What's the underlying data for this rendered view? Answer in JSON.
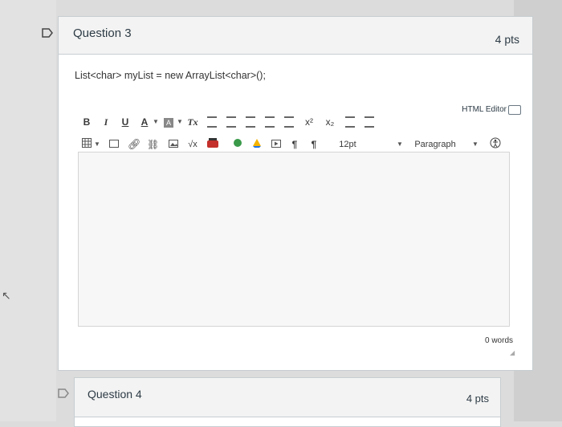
{
  "question3": {
    "title": "Question 3",
    "points": "4 pts",
    "code": "List<char> myList = new ArrayList<char>();",
    "html_editor_label": "HTML Editor",
    "word_count": "0 words",
    "toolbar1": [
      "B",
      "I",
      "U",
      "A",
      "A",
      "Tx",
      "x²",
      "x₂"
    ],
    "toolbar2": {
      "font_size": "12pt",
      "block_format": "Paragraph",
      "sqrt_label": "√x",
      "ltr_label": "¶",
      "rtl_label": "¶"
    }
  },
  "question4": {
    "title": "Question 4",
    "points": "4 pts"
  },
  "colors": {
    "header_bg": "#f3f3f3",
    "border": "#c7cdd1",
    "editor_bg": "#f7f7f7",
    "text": "#2d3b45"
  },
  "icons": [
    "flag-icon",
    "table-icon",
    "link-icon",
    "unlink-icon",
    "image-icon",
    "youtube-icon",
    "recycle-icon",
    "google-drive-icon",
    "media-icon",
    "keyboard-icon",
    "accessibility-icon"
  ]
}
